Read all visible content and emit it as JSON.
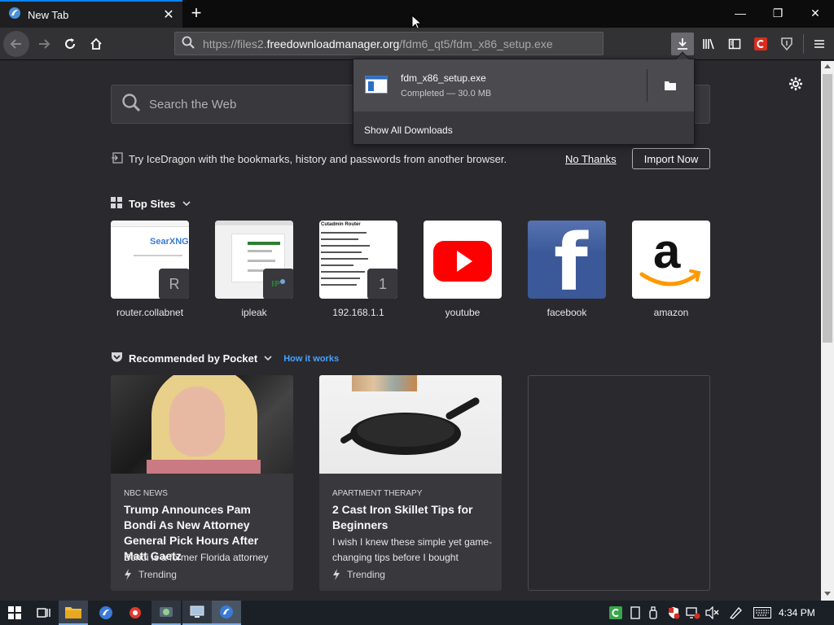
{
  "tab": {
    "title": "New Tab",
    "close": "✕",
    "new_tab": "+"
  },
  "window": {
    "minimize": "—",
    "restore": "❐",
    "close": "✕"
  },
  "url": {
    "prefix": "https://files2.",
    "host": "freedownloadmanager.org",
    "path": "/fdm6_qt5/fdm_x86_setup.exe"
  },
  "search": {
    "placeholder": "Search the Web"
  },
  "import_notice": {
    "text": "Try IceDragon with the bookmarks, history and passwords from another browser.",
    "no_thanks": "No Thanks",
    "import_now": "Import Now"
  },
  "top_sites": {
    "title": "Top Sites",
    "items": [
      {
        "label": "router.collabnet",
        "thumb_text": "SearXNG",
        "badge": "R"
      },
      {
        "label": "ipleak",
        "badge": ""
      },
      {
        "label": "192.168.1.1",
        "thumb_title": "Cutadmin Router",
        "badge": "1"
      },
      {
        "label": "youtube"
      },
      {
        "label": "facebook",
        "glyph": "f"
      },
      {
        "label": "amazon",
        "glyph": "a"
      }
    ]
  },
  "pocket": {
    "title": "Recommended by Pocket",
    "how_it_works": "How it works",
    "cards": [
      {
        "source": "NBC NEWS",
        "headline": "Trump Announces Pam Bondi As New Attorney General Pick Hours After Matt Gaetz",
        "excerpt": "Bondi is a former Florida attorney",
        "trend": "Trending"
      },
      {
        "source": "APARTMENT THERAPY",
        "headline": "2 Cast Iron Skillet Tips for Beginners",
        "excerpt": "I wish I knew these simple yet game-changing tips before I bought",
        "trend": "Trending"
      }
    ]
  },
  "downloads": {
    "filename": "fdm_x86_setup.exe",
    "status": "Completed — 30.0 MB",
    "show_all": "Show All Downloads"
  },
  "taskbar": {
    "clock": "4:34 PM"
  },
  "colors": {
    "accent": "#0a84ff",
    "pocket_link": "#45a1ff",
    "youtube_red": "#ff0000",
    "facebook_blue": "#3b5998",
    "amazon_orange": "#ff9900"
  }
}
